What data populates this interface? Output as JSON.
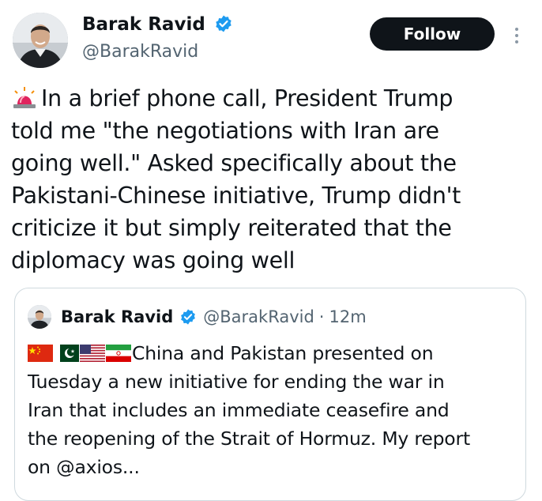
{
  "author": {
    "display_name": "Barak Ravid",
    "handle": "@BarakRavid",
    "verified": true
  },
  "actions": {
    "follow_label": "Follow",
    "more_icon": "more-vertical-icon"
  },
  "tweet": {
    "leading_emoji": "rotating-light-icon",
    "text": "In a brief phone call, President Trump\ntold me \"the negotiations with Iran are\ngoing well.\" Asked specifically about the\nPakistani-Chinese initiative, Trump didn't\ncriticize it but simply reiterated that the\ndiplomacy was going well"
  },
  "quoted_tweet": {
    "display_name": "Barak Ravid",
    "handle": "@BarakRavid",
    "separator": "·",
    "time": "12m",
    "leading_flags": [
      "china-flag-icon",
      "pakistan-flag-icon",
      "usa-flag-icon",
      "iran-flag-icon"
    ],
    "text": "China and Pakistan presented on\nTuesday a new initiative for ending the war in\nIran that includes an immediate ceasefire and\nthe reopening of the Strait of Hormuz. My report\non @axios..."
  },
  "colors": {
    "verified_blue": "#1d9bf0",
    "follow_button_bg": "#0f1419",
    "secondary_text": "#536471",
    "card_border": "#cfd9de"
  }
}
